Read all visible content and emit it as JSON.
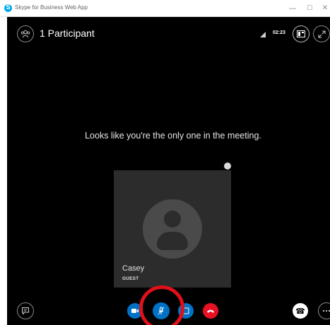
{
  "window": {
    "title": "Skype for Business Web App",
    "minimize_glyph": "—",
    "maximize_glyph": "☐",
    "close_glyph": "✕"
  },
  "meeting": {
    "participant_count_label": "1 Participant",
    "call_duration": "02:23",
    "empty_message": "Looks like you're the only one in the meeting."
  },
  "participant": {
    "name": "Casey",
    "role": "GUEST",
    "avatar_icon": "person-placeholder-icon"
  },
  "controls": {
    "video": {
      "icon": "video-camera-icon",
      "state": "on"
    },
    "mic": {
      "icon": "microphone-muted-icon",
      "state": "muted"
    },
    "share": {
      "icon": "present-screen-icon"
    },
    "hangup": {
      "icon": "hang-up-icon"
    },
    "phone": {
      "icon": "phone-icon",
      "glyph": "☎"
    },
    "more": {
      "icon": "more-options-icon"
    },
    "chat": {
      "icon": "chat-icon"
    }
  },
  "colors": {
    "stage_background": "#000000",
    "control_blue": "#0072c6",
    "hangup_red": "#e81123",
    "annotation_ring": "#e0101a"
  }
}
